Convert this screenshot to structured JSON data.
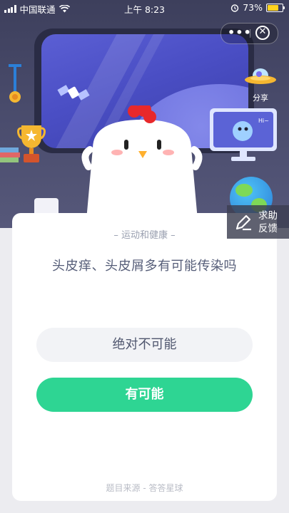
{
  "status_bar": {
    "carrier": "中国联通",
    "time": "上午 8:23",
    "battery_percent": "73%",
    "battery_level": 0.73,
    "battery_color": "#ffd21e"
  },
  "capsule": {
    "more_label": "•••",
    "close_label": "✕"
  },
  "share": {
    "label": "分享"
  },
  "monitor_text": "Hi~",
  "help": {
    "line1": "求助",
    "line2": "反馈"
  },
  "quiz": {
    "category": "运动和健康",
    "question": "头皮痒、头皮屑多有可能传染吗",
    "options": [
      "绝对不可能",
      "有可能"
    ],
    "source": "题目来源 - 答答星球"
  },
  "colors": {
    "accent": "#2ed593",
    "card": "#ffffff",
    "scene_bg": "#4b4d6e"
  },
  "icons": [
    "signal-icon",
    "wifi-icon",
    "alarm-icon",
    "battery-icon",
    "more-icon",
    "close-icon",
    "ufo-icon",
    "edit-icon"
  ]
}
